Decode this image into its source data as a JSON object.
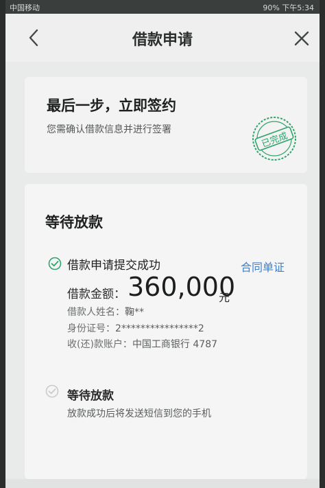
{
  "statusbar": {
    "left": "中国移动",
    "right": "90% 下午5:34"
  },
  "navbar": {
    "title": "借款申请"
  },
  "final_step": {
    "title": "最后一步，立即签约",
    "subtitle": "您需确认借款信息并进行签署",
    "stamp_text": "已完成"
  },
  "waiting": {
    "title": "等待放款",
    "step1": {
      "label": "借款申请提交成功",
      "link": "合同单证",
      "amount_label": "借款金额：",
      "amount": "360,000",
      "amount_unit": "元",
      "borrower_label": "借款人姓名：",
      "borrower_value": "鞠**",
      "id_label": "身份证号：",
      "id_value": "2****************2",
      "account_label": "收(还)款账户：",
      "account_value": "中国工商银行 4787"
    },
    "step2": {
      "label": "等待放款",
      "sub": "放款成功后将发送短信到您的手机"
    }
  },
  "colors": {
    "accent_green": "#2fa36b",
    "link_blue": "#3f7fc9"
  }
}
